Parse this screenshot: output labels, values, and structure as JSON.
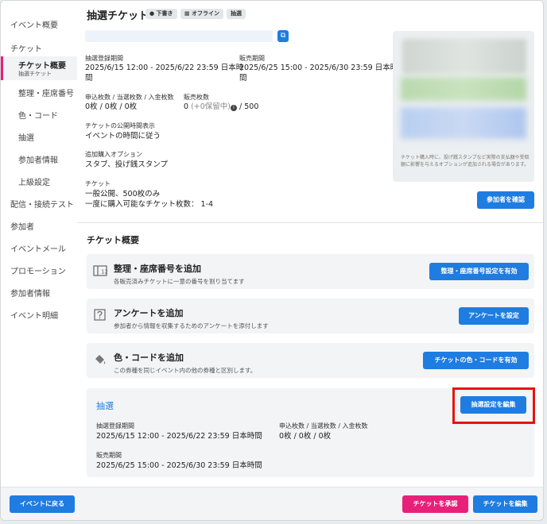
{
  "sidebar": {
    "items": [
      {
        "id": "event-overview",
        "label": "イベント概要"
      },
      {
        "id": "ticket",
        "label": "チケット"
      },
      {
        "id": "ticket-overview",
        "label": "チケット概要",
        "sub": "抽選チケット",
        "active": true
      },
      {
        "id": "numbering",
        "label": "整理・座席番号"
      },
      {
        "id": "color-code",
        "label": "色・コード"
      },
      {
        "id": "lottery",
        "label": "抽選"
      },
      {
        "id": "attendee-info",
        "label": "参加者情報"
      },
      {
        "id": "advanced",
        "label": "上級設定"
      },
      {
        "id": "stream-test",
        "label": "配信・接続テスト"
      },
      {
        "id": "attendees",
        "label": "参加者"
      },
      {
        "id": "event-mail",
        "label": "イベントメール"
      },
      {
        "id": "promotion",
        "label": "プロモーション"
      },
      {
        "id": "attendee-info-2",
        "label": "参加者情報"
      },
      {
        "id": "event-statement",
        "label": "イベント明細"
      }
    ]
  },
  "header": {
    "title": "抽選チケット",
    "badges": [
      "● 下書き",
      "▦ オフライン",
      "抽選"
    ]
  },
  "details": {
    "lottery_period_label": "抽選登録期間",
    "lottery_period_line1": "2025/6/15 12:00 - 2025/6/22 23:59 日本時",
    "lottery_period_line2": "間",
    "sales_period_label": "販売期間",
    "sales_period_line1": "2025/6/25 15:00 - 2025/6/30 23:59 日本時",
    "sales_period_line2": "間",
    "counts_label": "申込枚数 / 当選枚数 / 入金枚数",
    "counts_value": "0枚 / 0枚 / 0枚",
    "sold_label": "販売枚数",
    "sold_prefix": "0",
    "sold_reserved": "(+0保留中)",
    "sold_suffix": "/ 500",
    "public_time_label": "チケットの公開時間表示",
    "public_time_value": "イベントの時間に従う",
    "options_label": "追加購入オプション",
    "options_value": "スタブ、投げ銭スタンプ",
    "ticket_label": "チケット",
    "ticket_line1": "一般公開、500枚のみ",
    "ticket_line2": "一度に購入可能なチケット枚数： 1-4"
  },
  "preview": {
    "note": "チケット購入時に、投げ銭スタンプなど実際の支払額や受取額に影響を与えるオプションが追加される場合があります。"
  },
  "buttons": {
    "view_attendees": "参加者を確認",
    "enable_numbering": "整理・座席番号設定を有効",
    "set_survey": "アンケートを設定",
    "enable_color": "チケットの色・コードを有効",
    "edit_lottery": "抽選設定を編集",
    "back_to_event": "イベントに戻る",
    "approve_ticket": "チケットを承認",
    "edit_ticket": "チケットを編集"
  },
  "overview": {
    "title": "チケット概要",
    "cards": [
      {
        "title": "整理・座席番号を追加",
        "desc": "各販売済みチケットに一意の番号を割り当てます"
      },
      {
        "title": "アンケートを追加",
        "desc": "参加者から情報を収集するためのアンケートを添付します"
      },
      {
        "title": "色・コードを追加",
        "desc": "この券種を同じイベント内の他の券種と区別します。"
      }
    ]
  },
  "lottery_card": {
    "title": "抽選",
    "period_label": "抽選登録期間",
    "period_value": "2025/6/15 12:00 - 2025/6/22 23:59 日本時間",
    "counts_label": "申込枚数 / 当選枚数 / 入金枚数",
    "counts_value": "0枚 / 0枚 / 0枚",
    "sales_label": "販売期間",
    "sales_value": "2025/6/25 15:00 - 2025/6/30 23:59 日本時間"
  },
  "colors": {
    "accent": "#1f7ce0",
    "pink": "#e8207a",
    "highlight": "#e8130e"
  }
}
